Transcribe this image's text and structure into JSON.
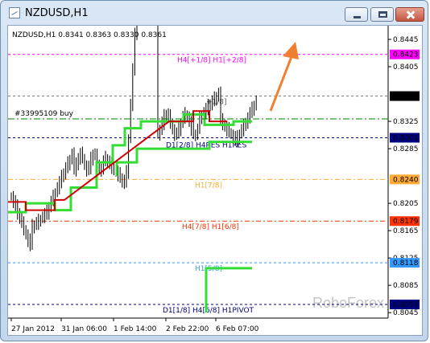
{
  "window": {
    "title": "NZDUSD,H1",
    "buttons": {
      "minimize": "minimize",
      "maximize": "maximize",
      "close": "close"
    }
  },
  "chart": {
    "header": "NZDUSD,H1  0.8341 0.8363 0.8330 0.8361",
    "watermark": "RoboForex",
    "order_label": "#33995109 buy",
    "colors": {
      "background": "#ffffff",
      "candles": "#000000",
      "green_line": "#33dd33",
      "red_line": "#cc0000",
      "arrow": "#f08030",
      "magenta": "#ff00ff",
      "orange": "#ffaa33",
      "red_level": "#ff3300",
      "blue": "#3399ff",
      "navy": "#000080",
      "buy_line": "#008000"
    },
    "price_labels": [
      "0.8445",
      "0.8405",
      "0.8325",
      "0.8285",
      "0.8205",
      "0.8165",
      "0.8125",
      "0.8085",
      "0.8045"
    ],
    "highlight_labels": [
      {
        "text": "0.8423",
        "fill": "#ff00ff",
        "text_color": "#ffffff",
        "key": "magenta"
      },
      {
        "text": "0.8362",
        "fill": "#000000",
        "text_color": "#ffffff",
        "key": "current"
      },
      {
        "text": "0.8301",
        "fill": "#000080",
        "text_color": "#ffffff",
        "key": "navy"
      },
      {
        "text": "0.8240",
        "fill": "#ffaa33",
        "text_color": "#ffffff",
        "key": "orange"
      },
      {
        "text": "0.8179",
        "fill": "#ff3300",
        "text_color": "#ffffff",
        "key": "red"
      },
      {
        "text": "0.8118",
        "fill": "#3399ff",
        "text_color": "#ffffff",
        "key": "blue"
      },
      {
        "text": "0.8057",
        "fill": "#000080",
        "text_color": "#ffffff",
        "key": "navy2"
      }
    ],
    "time_labels": [
      "27 Jan 2012",
      "31 Jan 06:00",
      "1 Feb 14:00",
      "2 Feb 22:00",
      "6 Feb 07:00"
    ],
    "levels": [
      {
        "text": "H4[+1/8] H1[+2/8]",
        "color": "#ff00ff"
      },
      {
        "text": "+1/8]",
        "color": "#555555"
      },
      {
        "text": "D1[2/8] H4RES H1RES",
        "color": "#000080"
      },
      {
        "text": "H1[7/8]",
        "color": "#ffaa33"
      },
      {
        "text": "H4[7/8] H1[6/8]",
        "color": "#ff3300"
      },
      {
        "text": "H1[5/8]",
        "color": "#3399ff"
      },
      {
        "text": "D1[1/8] H4[6/8] H1PIVOT",
        "color": "#000080"
      }
    ]
  },
  "chart_data": {
    "type": "candlestick",
    "symbol": "NZDUSD",
    "timeframe": "H1",
    "ohlc_current": {
      "open": 0.8341,
      "high": 0.8363,
      "low": 0.833,
      "close": 0.8361
    },
    "y_ticks": [
      0.8445,
      0.8405,
      0.8325,
      0.8285,
      0.8205,
      0.8165,
      0.8125,
      0.8085,
      0.8045
    ],
    "x_ticks": [
      "27 Jan 2012",
      "31 Jan 06:00",
      "1 Feb 14:00",
      "2 Feb 22:00",
      "6 Feb 07:00"
    ],
    "levels": [
      0.8423,
      0.8362,
      0.8301,
      0.824,
      0.8179,
      0.8118,
      0.8057
    ],
    "ylim": [
      0.8037,
      0.8465
    ]
  }
}
